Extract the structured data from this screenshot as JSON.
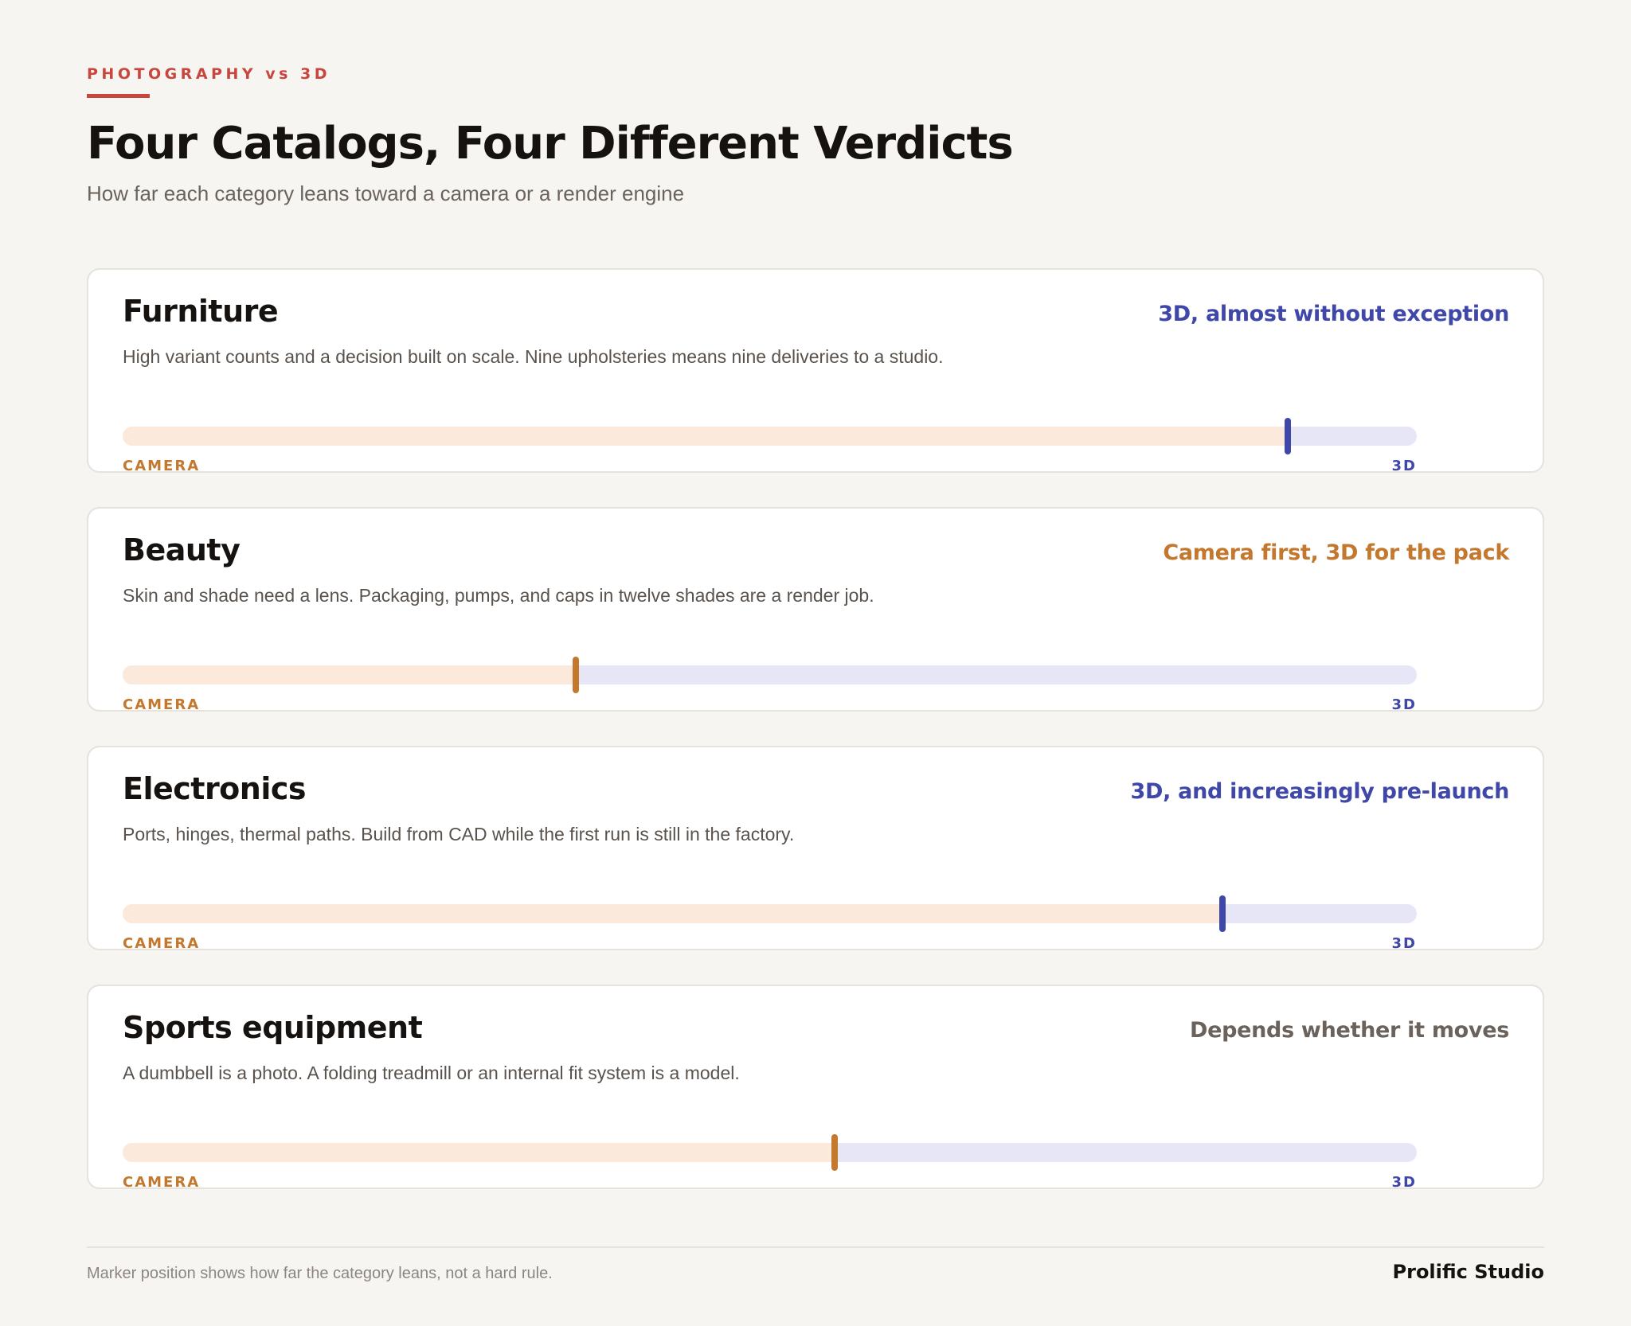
{
  "header": {
    "eyebrow": "PHOTOGRAPHY vs 3D",
    "title": "Four Catalogs, Four Different Verdicts",
    "subtitle": "How far each category leans toward a camera or a render engine"
  },
  "colors": {
    "accent_red": "#c8463e",
    "camera": "#c4782d",
    "render_3d": "#3f47a8",
    "neutral": "#6a625b",
    "track_camera": "#fbeadb",
    "track_3d": "#e6e6f6"
  },
  "scale": {
    "left_label": "CAMERA",
    "right_label": "3D"
  },
  "categories": [
    {
      "name": "Furniture",
      "verdict": "3D, almost without exception",
      "verdict_color": "#3f47a8",
      "description": "High variant counts and a decision built on scale. Nine upholsteries means nine deliveries to a studio.",
      "lean": 0.9,
      "marker_color": "#3f47a8"
    },
    {
      "name": "Beauty",
      "verdict": "Camera first, 3D for the pack",
      "verdict_color": "#c4782d",
      "description": "Skin and shade need a lens. Packaging, pumps, and caps in twelve shades are a render job.",
      "lean": 0.35,
      "marker_color": "#c4782d"
    },
    {
      "name": "Electronics",
      "verdict": "3D, and increasingly pre-launch",
      "verdict_color": "#3f47a8",
      "description": "Ports, hinges, thermal paths. Build from CAD while the first run is still in the factory.",
      "lean": 0.85,
      "marker_color": "#3f47a8"
    },
    {
      "name": "Sports equipment",
      "verdict": "Depends whether it moves",
      "verdict_color": "#6a625b",
      "description": "A dumbbell is a photo. A folding treadmill or an internal fit system is a model.",
      "lean": 0.55,
      "marker_color": "#c4782d"
    }
  ],
  "footer": {
    "note": "Marker position shows how far the category leans, not a hard rule.",
    "brand": "Prolific Studio"
  }
}
